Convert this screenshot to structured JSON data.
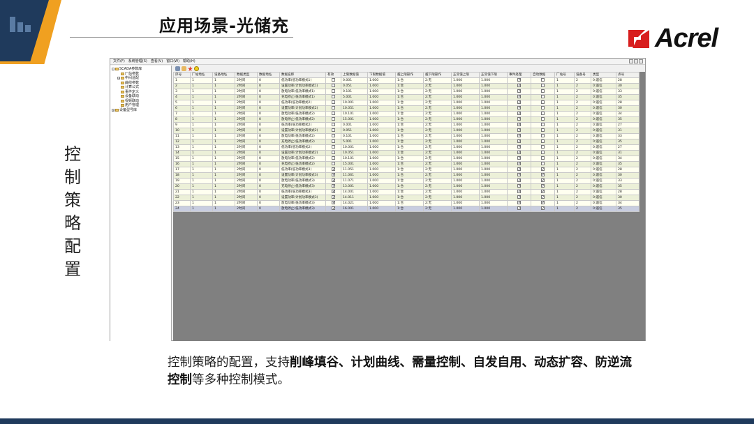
{
  "slide": {
    "title": "应用场景-光储充",
    "logo_text": "Acrel",
    "side_label": [
      "控",
      "制",
      "策",
      "略",
      "配",
      "置"
    ],
    "caption_parts": [
      {
        "text": "控制策略的配置，支持",
        "bold": false
      },
      {
        "text": "削峰填谷、计划曲线、需量控制、自发自用、动态扩容、防逆流控制",
        "bold": true
      },
      {
        "text": "等多种控制模式。",
        "bold": false
      }
    ],
    "colors": {
      "accent_orange": "#f0a020",
      "accent_navy": "#1f3a5c",
      "logo_red": "#d81e1e"
    }
  },
  "app": {
    "menu": [
      "文件(F)",
      "系统管理(S)",
      "查看(V)",
      "窗口(W)",
      "帮助(H)"
    ],
    "toolbar_icons": [
      "wrench-icon",
      "hand-icon",
      "star-icon",
      "bulb-icon"
    ],
    "tree": [
      {
        "label": "SCADA参数库",
        "level": 0,
        "expand": "-"
      },
      {
        "label": "厂站参数",
        "level": 1,
        "expand": ""
      },
      {
        "label": "中间遥配",
        "level": 1,
        "expand": "+"
      },
      {
        "label": "曲线参数",
        "level": 1,
        "expand": ""
      },
      {
        "label": "计算公式",
        "level": 1,
        "expand": ""
      },
      {
        "label": "事件定义",
        "level": 1,
        "expand": ""
      },
      {
        "label": "设备联动",
        "level": 1,
        "expand": ""
      },
      {
        "label": "视频联动",
        "level": 1,
        "expand": ""
      },
      {
        "label": "用户管理",
        "level": 1,
        "expand": ""
      },
      {
        "label": "设备型号库",
        "level": 0,
        "expand": "+"
      }
    ],
    "columns": [
      "序号",
      "厂站地址",
      "设备地址",
      "数据类型",
      "数据地址",
      "数据名称",
      "有效",
      "上限数据值",
      "下限数据值",
      "越上限操作",
      "越下限操作",
      "正常值上限",
      "正常值下限",
      "事件处理",
      "自动数据",
      "厂站号",
      "设备号",
      "类型",
      "点号"
    ],
    "rows": [
      [
        "1",
        "1",
        "1",
        "2时间",
        "0",
        "低功率(低功率模式1)",
        "0",
        "0.001",
        "1.000",
        "1:合",
        "2:无",
        "1.000",
        "1.000",
        "1",
        "0",
        "1",
        "2",
        "0:遥信",
        "28"
      ],
      [
        "2",
        "1",
        "1",
        "2时间",
        "0",
        "设置功率(计划功率模式1)",
        "0",
        "0.051",
        "1.000",
        "1:合",
        "2:无",
        "1.000",
        "1.000",
        "1",
        "0",
        "1",
        "2",
        "0:遥信",
        "30"
      ],
      [
        "3",
        "1",
        "1",
        "2时间",
        "0",
        "放电功率(低功率模式1)",
        "0",
        "0.101",
        "1.000",
        "1:合",
        "2:无",
        "1.000",
        "1.000",
        "1",
        "0",
        "1",
        "2",
        "0:遥信",
        "33"
      ],
      [
        "4",
        "1",
        "1",
        "2时间",
        "0",
        "充电停止(低功率模式1)",
        "0",
        "5.001",
        "1.000",
        "1:合",
        "2:无",
        "1.000",
        "1.000",
        "1",
        "0",
        "1",
        "2",
        "0:遥信",
        "35"
      ],
      [
        "5",
        "1",
        "1",
        "2时间",
        "0",
        "低功率(低功率模式2)",
        "0",
        "10.001",
        "1.000",
        "1:合",
        "2:无",
        "1.000",
        "1.000",
        "1",
        "0",
        "1",
        "2",
        "0:遥信",
        "28"
      ],
      [
        "6",
        "1",
        "1",
        "2时间",
        "0",
        "设置功率(计划功率模式2)",
        "0",
        "10.051",
        "1.000",
        "1:合",
        "2:无",
        "1.000",
        "1.000",
        "1",
        "0",
        "1",
        "2",
        "0:遥信",
        "30"
      ],
      [
        "7",
        "1",
        "1",
        "2时间",
        "0",
        "放电功率(低功率模式2)",
        "0",
        "10.101",
        "1.000",
        "1:合",
        "2:无",
        "1.000",
        "1.000",
        "1",
        "0",
        "1",
        "2",
        "0:遥信",
        "34"
      ],
      [
        "8",
        "1",
        "1",
        "2时间",
        "0",
        "放电停止(低功率模式2)",
        "0",
        "15.001",
        "1.000",
        "1:合",
        "2:无",
        "1.000",
        "1.000",
        "1",
        "0",
        "1",
        "2",
        "0:遥信",
        "35"
      ],
      [
        "9",
        "1",
        "1",
        "2时间",
        "0",
        "低功率(低功率模式2)",
        "0",
        "0.001",
        "1.000",
        "1:合",
        "2:无",
        "1.000",
        "1.000",
        "1",
        "0",
        "1",
        "2",
        "0:遥信",
        "27"
      ],
      [
        "10",
        "1",
        "1",
        "2时间",
        "0",
        "设置功率(计划功率模式2)",
        "0",
        "0.051",
        "1.000",
        "1:合",
        "2:无",
        "1.000",
        "1.000",
        "1",
        "0",
        "1",
        "2",
        "0:遥信",
        "31"
      ],
      [
        "11",
        "1",
        "1",
        "2时间",
        "0",
        "放电功率(低功率模式2)",
        "0",
        "0.101",
        "1.000",
        "1:合",
        "2:无",
        "1.000",
        "1.000",
        "1",
        "0",
        "1",
        "2",
        "0:遥信",
        "33"
      ],
      [
        "12",
        "1",
        "1",
        "2时间",
        "0",
        "充电停止(低功率模式2)",
        "0",
        "5.001",
        "1.000",
        "1:合",
        "2:无",
        "1.000",
        "1.000",
        "1",
        "0",
        "1",
        "2",
        "0:遥信",
        "35"
      ],
      [
        "13",
        "1",
        "1",
        "2时间",
        "0",
        "低功率(低功率模式2)",
        "0",
        "10.001",
        "1.000",
        "1:合",
        "2:无",
        "1.000",
        "1.000",
        "1",
        "0",
        "1",
        "2",
        "0:遥信",
        "27"
      ],
      [
        "14",
        "1",
        "1",
        "2时间",
        "0",
        "设置功率(计划功率模式2)",
        "0",
        "10.051",
        "1.000",
        "1:合",
        "2:无",
        "1.000",
        "1.000",
        "1",
        "0",
        "1",
        "2",
        "0:遥信",
        "31"
      ],
      [
        "15",
        "1",
        "1",
        "2时间",
        "0",
        "放电功率(低功率模式2)",
        "0",
        "10.101",
        "1.000",
        "1:合",
        "2:无",
        "1.000",
        "1.000",
        "1",
        "0",
        "1",
        "2",
        "0:遥信",
        "34"
      ],
      [
        "16",
        "1",
        "1",
        "2时间",
        "0",
        "充电停止(低功率模式2)",
        "0",
        "15.001",
        "1.000",
        "1:合",
        "2:无",
        "1.000",
        "1.000",
        "1",
        "0",
        "1",
        "2",
        "0:遥信",
        "35"
      ],
      [
        "17",
        "1",
        "1",
        "2时间",
        "0",
        "低功率(低功率模式3)",
        "1",
        "11.051",
        "1.000",
        "1:合",
        "2:无",
        "1.000",
        "1.000",
        "1",
        "1",
        "1",
        "2",
        "0:遥信",
        "28"
      ],
      [
        "18",
        "1",
        "1",
        "2时间",
        "0",
        "设置功率(计划功率模式3)",
        "1",
        "11.061",
        "1.000",
        "1:合",
        "2:无",
        "1.000",
        "1.000",
        "1",
        "1",
        "1",
        "2",
        "0:遥信",
        "30"
      ],
      [
        "19",
        "1",
        "1",
        "2时间",
        "0",
        "放电功率(低功率模式3)",
        "1",
        "11.071",
        "1.000",
        "1:合",
        "2:无",
        "1.000",
        "1.000",
        "1",
        "1",
        "1",
        "2",
        "0:遥信",
        "33"
      ],
      [
        "20",
        "1",
        "1",
        "2时间",
        "0",
        "充电停止(低功率模式3)",
        "1",
        "13.001",
        "1.000",
        "1:合",
        "2:无",
        "1.000",
        "1.000",
        "1",
        "1",
        "1",
        "2",
        "0:遥信",
        "35"
      ],
      [
        "21",
        "1",
        "1",
        "2时间",
        "0",
        "低功率(低功率模式3)",
        "1",
        "14.001",
        "1.000",
        "1:合",
        "2:无",
        "1.000",
        "1.000",
        "1",
        "1",
        "1",
        "2",
        "0:遥信",
        "28"
      ],
      [
        "22",
        "1",
        "1",
        "2时间",
        "0",
        "设置功率(计划功率模式3)",
        "1",
        "14.011",
        "1.000",
        "1:合",
        "2:无",
        "1.000",
        "1.000",
        "1",
        "1",
        "1",
        "2",
        "0:遥信",
        "30"
      ],
      [
        "23",
        "1",
        "1",
        "2时间",
        "0",
        "放电功率(低功率模式3)",
        "1",
        "14.021",
        "1.000",
        "1:合",
        "2:无",
        "1.000",
        "1.000",
        "1",
        "1",
        "1",
        "2",
        "0:遥信",
        "34"
      ],
      [
        "24",
        "1",
        "1",
        "2时间",
        "0",
        "放电停止(低功率模式3)",
        "1",
        "16.001",
        "1.000",
        "1:合",
        "2:无",
        "1.000",
        "1.000",
        "1",
        "1",
        "1",
        "2",
        "0:遥信",
        "35"
      ]
    ]
  }
}
